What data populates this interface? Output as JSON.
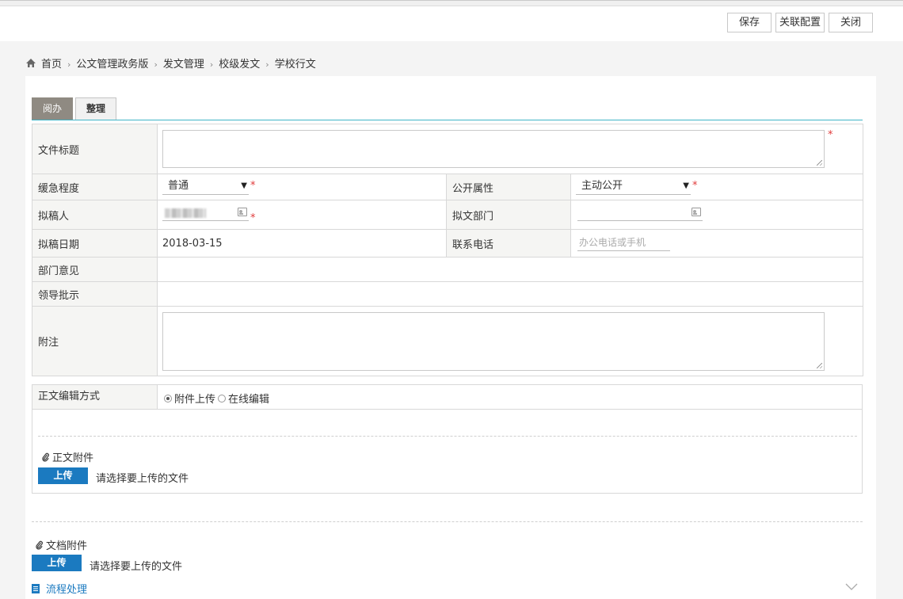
{
  "toolbar": {
    "save_label": "保存",
    "link_config_label": "关联配置",
    "close_label": "关闭"
  },
  "breadcrumb": {
    "home": "首页",
    "items": [
      "公文管理政务版",
      "发文管理",
      "校级发文",
      "学校行文"
    ],
    "separator": "›"
  },
  "tabs": [
    {
      "label": "阅办",
      "active": true
    },
    {
      "label": "整理",
      "active": false
    }
  ],
  "form": {
    "title_label": "文件标题",
    "title_value": "",
    "urgency_label": "缓急程度",
    "urgency_value": "普通",
    "publicity_label": "公开属性",
    "publicity_value": "主动公开",
    "drafter_label": "拟稿人",
    "drafter_value": "",
    "draft_dept_label": "拟文部门",
    "draft_dept_value": "",
    "draft_date_label": "拟稿日期",
    "draft_date_value": "2018-03-15",
    "phone_label": "联系电话",
    "phone_placeholder": "办公电话或手机",
    "dept_opinion_label": "部门意见",
    "dept_opinion_value": "",
    "leader_instruction_label": "领导批示",
    "leader_instruction_value": "",
    "note_label": "附注",
    "note_value": "",
    "required_mark": "*"
  },
  "body_edit": {
    "label": "正文编辑方式",
    "options": [
      {
        "label": "附件上传",
        "selected": true
      },
      {
        "label": "在线编辑",
        "selected": false
      }
    ],
    "attachment_title": "正文附件",
    "upload_label": "上传",
    "upload_hint": "请选择要上传的文件"
  },
  "doc_attachment": {
    "title": "文档附件",
    "upload_label": "上传",
    "upload_hint": "请选择要上传的文件"
  },
  "flow": {
    "label": "流程处理"
  },
  "colors": {
    "accent": "#1b7ac0",
    "tab_active": "#8f8a82",
    "tab_line": "#41b5c7",
    "required": "#e03b3b"
  }
}
